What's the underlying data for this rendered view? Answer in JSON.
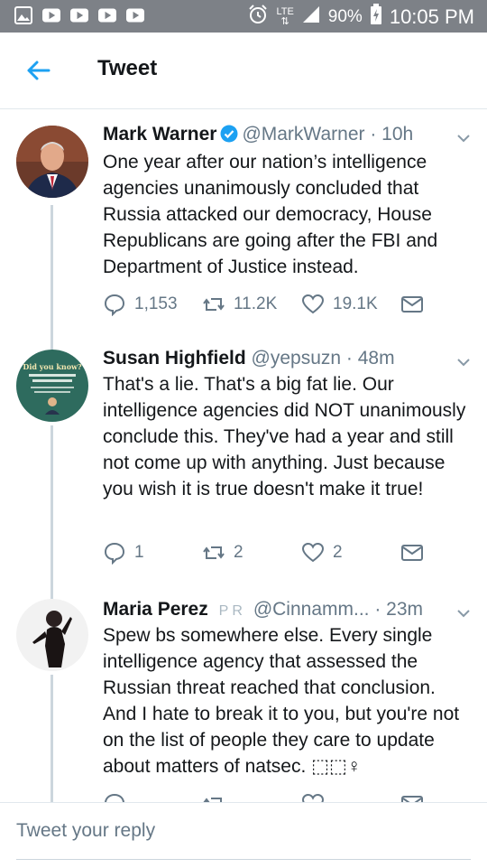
{
  "status_bar": {
    "network": "LTE",
    "battery": "90%",
    "time": "10:05 PM",
    "left_icons": [
      "gallery-icon",
      "youtube-icon",
      "youtube-icon",
      "youtube-icon",
      "youtube-icon"
    ]
  },
  "header": {
    "title": "Tweet"
  },
  "tweets": [
    {
      "name": "Mark Warner",
      "verified": true,
      "handle": "@MarkWarner · 10h",
      "text": "One year after our nation’s intelligence agencies unanimously concluded that Russia attacked our democracy, House Republicans are going after the FBI and Department of Justice instead.",
      "replies": "1,153",
      "retweets": "11.2K",
      "likes": "19.1K"
    },
    {
      "name": "Susan Highfield",
      "handle": "@yepsuzn · 48m",
      "avatar_text": "Did you know?",
      "text": "That's a lie. That's a big fat lie. Our intelligence agencies did NOT unanimously conclude this. They've had a year and still not come up with anything. Just because you wish it is true doesn't make it true!",
      "replies": "1",
      "retweets": "2",
      "likes": "2"
    },
    {
      "name": "Maria Perez",
      "badges": "P R",
      "handle": "@Cinnamm... · 23m",
      "text": "Spew bs somewhere else. Every single intelligence agency that assessed the Russian threat reached that conclusion. And I hate to break it to you, but you're not on the list of people they care to update about matters of natsec. ⬚⬚♀"
    }
  ],
  "reply": {
    "placeholder": "Tweet your reply"
  },
  "colors": {
    "accent": "#1da1f2",
    "muted": "#657786",
    "status_bar": "#7d8187"
  }
}
